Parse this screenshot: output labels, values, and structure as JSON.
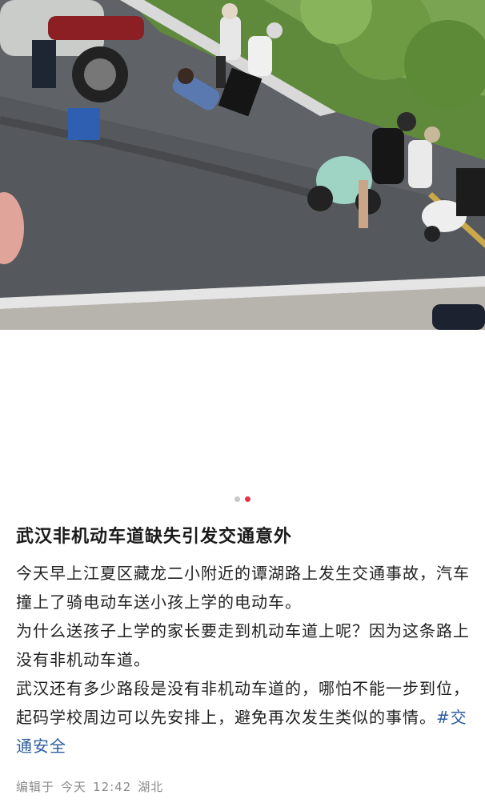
{
  "post": {
    "title": "武汉非机动车道缺失引发交通意外",
    "paragraphs": [
      "今天早上江夏区藏龙二小附近的谭湖路上发生交通事故，汽车撞上了骑电动车送小孩上学的电动车。",
      "为什么送孩子上学的家长要走到机动车道上呢？因为这条路上没有非机动车道。",
      "武汉还有多少路段是没有非机动车道的，哪怕不能一步到位，起码学校周边可以先安排上，避免再次发生类似的事情。"
    ],
    "tag": "#交通安全",
    "meta": {
      "edited_label": "编辑于",
      "day": "今天",
      "time": "12:42",
      "location": "湖北"
    }
  },
  "carousel": {
    "total": 2,
    "active_index": 1
  },
  "colors": {
    "dot_active": "#e8334a",
    "dot_inactive": "#c8c8c8",
    "tag": "#2b5c9e"
  }
}
